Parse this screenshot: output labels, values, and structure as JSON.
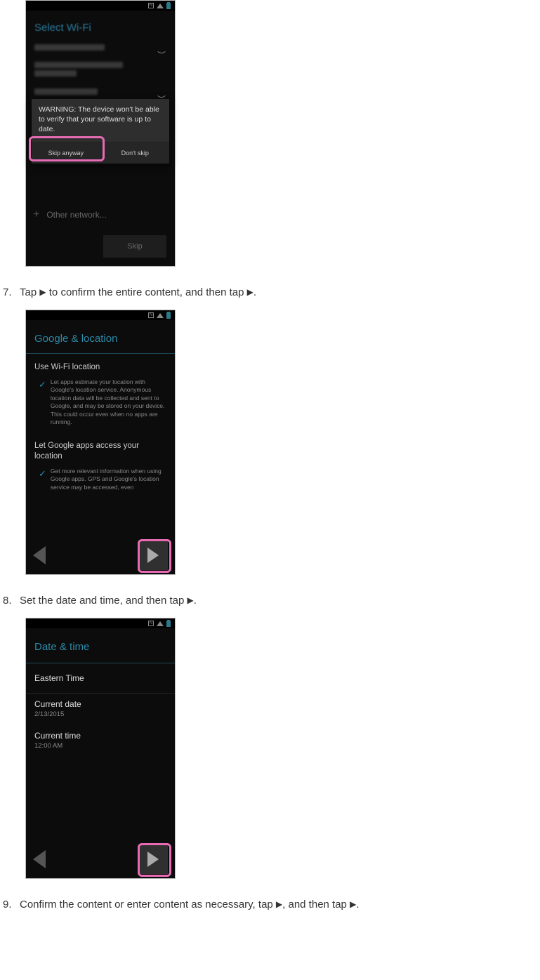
{
  "steps": {
    "s7": {
      "num": "7.",
      "text_a": "Tap ",
      "text_b": " to confirm the entire content, and then tap ",
      "text_c": "."
    },
    "s8": {
      "num": "8.",
      "text_a": "Set the date and time, and then tap ",
      "text_b": "."
    },
    "s9": {
      "num": "9.",
      "text_a": "Confirm the content or enter content as necessary, tap ",
      "text_b": ", and then tap ",
      "text_c": "."
    }
  },
  "glyphs": {
    "play": "▶"
  },
  "shot1": {
    "title": "Select Wi-Fi",
    "dialog_text": "WARNING: The device won't be able to verify that your software is up to date.",
    "btn_skip_anyway": "Skip anyway",
    "btn_dont_skip": "Don't skip",
    "other_network": "Other network...",
    "skip": "Skip"
  },
  "shot2": {
    "title": "Google & location",
    "sec1_label": "Use Wi-Fi location",
    "sec1_desc": "Let apps estimate your location with Google's location service. Anonymous location data will be collected and sent to Google, and may be stored on your device. This could occur even when no apps are running.",
    "sec2_label": "Let Google apps access your location",
    "sec2_desc": "Get more relevant information when using Google apps. GPS and Google's location service may be accessed, even"
  },
  "shot3": {
    "title": "Date & time",
    "timezone": "Eastern Time",
    "date_label": "Current date",
    "date_value": "2/13/2015",
    "time_label": "Current time",
    "time_value": "12:00 AM"
  }
}
